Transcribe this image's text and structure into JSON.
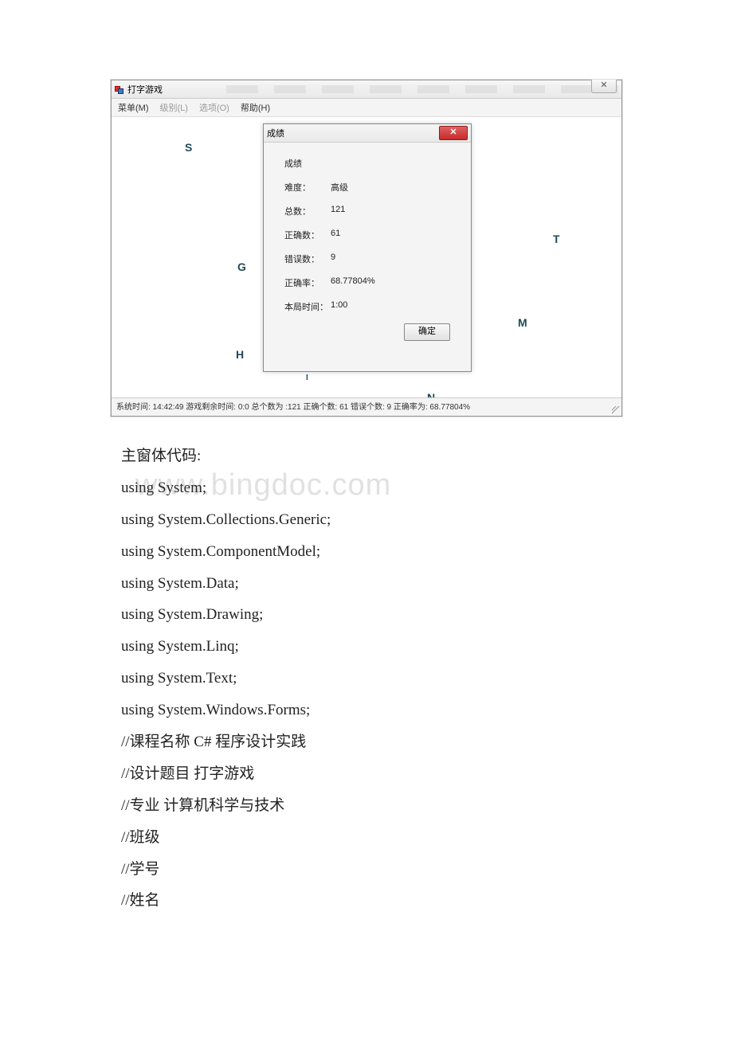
{
  "app": {
    "title": "打字游戏",
    "close_x": "✕"
  },
  "menu": {
    "caidan": "菜单(M)",
    "jibie": "级别(L)",
    "xuanxiang": "选项(O)",
    "bangzhu": "帮助(H)"
  },
  "letters": {
    "S": "S",
    "G": "G",
    "H": "H",
    "T": "T",
    "M": "M",
    "N": "N",
    "I": "I"
  },
  "dialog": {
    "title": "成绩",
    "group": "成绩",
    "difficulty_label": "难度：",
    "difficulty_value": "高级",
    "total_label": "总数：",
    "total_value": "121",
    "correct_label": "正确数：",
    "correct_value": "61",
    "wrong_label": "错误数：",
    "wrong_value": "9",
    "rate_label": "正确率：",
    "rate_value": "68.77804%",
    "time_label": "本局时间：",
    "time_value": "1:00",
    "ok": "确定",
    "close_x": "✕"
  },
  "status": "系统时间: 14:42:49  游戏剩余时间: 0:0  总个数为 :121  正确个数: 61  错误个数: 9  正确率为: 68.77804%",
  "doc": {
    "heading": "主窗体代码:",
    "lines": [
      "using System;",
      "using System.Collections.Generic;",
      "using System.ComponentModel;",
      "using System.Data;",
      "using System.Drawing;",
      "using System.Linq;",
      "using System.Text;",
      "using System.Windows.Forms;",
      "//课程名称 C# 程序设计实践",
      "//设计题目 打字游戏",
      "//专业 计算机科学与技术",
      "//班级",
      "//学号",
      "//姓名"
    ]
  },
  "watermark": "www.bingdoc.com"
}
